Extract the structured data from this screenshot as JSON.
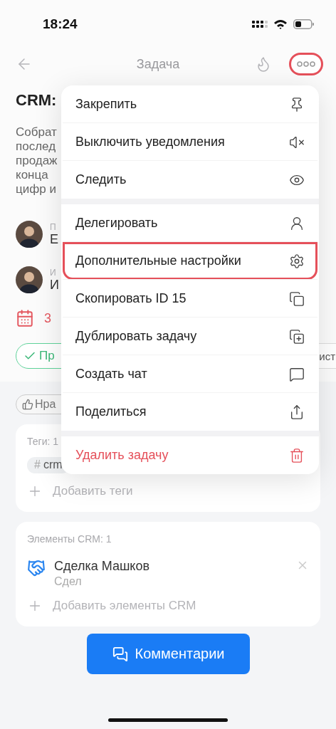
{
  "status_bar": {
    "time": "18:24"
  },
  "header": {
    "title": "Задача",
    "more_highlighted": true
  },
  "task": {
    "title": "CRM:",
    "description": [
      "Собрат",
      "послед",
      "продаж",
      "конца",
      "цифр и"
    ],
    "people": [
      {
        "role": "П",
        "name": "Е"
      },
      {
        "role": "И",
        "name": "И"
      }
    ],
    "deadline": "3",
    "status": "Пр",
    "second_pill": "ист",
    "like": "Нра"
  },
  "tags_card": {
    "title": "Теги: 1",
    "tags": [
      {
        "prefix": "#",
        "label": "crm"
      }
    ],
    "add": "Добавить теги"
  },
  "crm_card": {
    "title": "Элементы CRM: 1",
    "items": [
      {
        "name": "Сделка Машков",
        "type": "Сдел"
      }
    ],
    "add": "Добавить элементы CRM"
  },
  "comments_button": "Комментарии",
  "menu": {
    "groups": [
      [
        {
          "label": "Закрепить",
          "kind": "normal",
          "highlighted": false
        },
        {
          "label": "Выключить уведомления",
          "kind": "normal",
          "highlighted": false
        },
        {
          "label": "Следить",
          "kind": "normal",
          "highlighted": false
        }
      ],
      [
        {
          "label": "Делегировать",
          "kind": "normal",
          "highlighted": false
        },
        {
          "label": "Дополнительные настройки",
          "kind": "normal",
          "highlighted": true
        },
        {
          "label": "Скопировать ID 15",
          "kind": "normal",
          "highlighted": false
        },
        {
          "label": "Дублировать задачу",
          "kind": "normal",
          "highlighted": false
        },
        {
          "label": "Создать чат",
          "kind": "normal",
          "highlighted": false
        },
        {
          "label": "Поделиться",
          "kind": "normal",
          "highlighted": false
        }
      ],
      [
        {
          "label": "Удалить задачу",
          "kind": "danger",
          "highlighted": false
        }
      ]
    ]
  }
}
